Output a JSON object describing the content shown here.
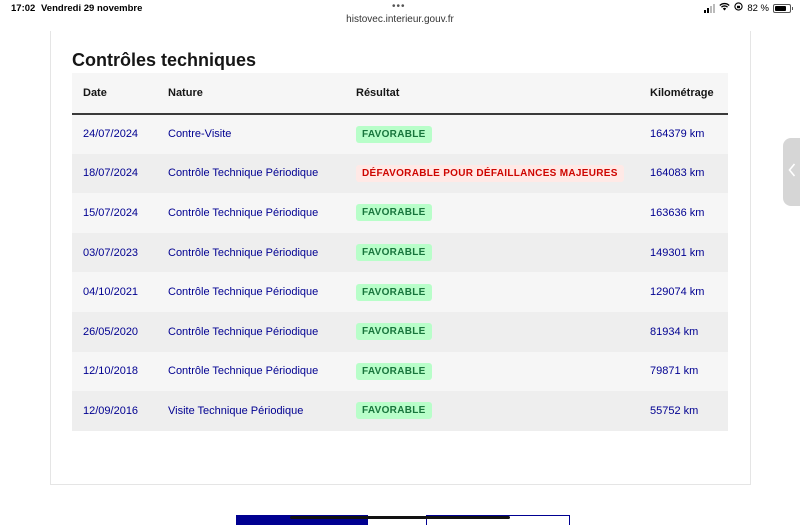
{
  "status_bar": {
    "time": "17:02",
    "date": "Vendredi 29 novembre",
    "battery": "82 %",
    "battery_level": 0.82
  },
  "browser": {
    "url": "histovec.interieur.gouv.fr"
  },
  "section": {
    "title": "Contrôles techniques"
  },
  "table": {
    "headers": {
      "date": "Date",
      "nature": "Nature",
      "resultat": "Résultat",
      "kilometrage": "Kilométrage"
    },
    "rows": [
      {
        "date": "24/07/2024",
        "nature": "Contre-Visite",
        "resultat": "FAVORABLE",
        "status": "ok",
        "km": "164379 km"
      },
      {
        "date": "18/07/2024",
        "nature": "Contrôle Technique Périodique",
        "resultat": "DÉFAVORABLE POUR DÉFAILLANCES MAJEURES",
        "status": "ko",
        "km": "164083 km"
      },
      {
        "date": "15/07/2024",
        "nature": "Contrôle Technique Périodique",
        "resultat": "FAVORABLE",
        "status": "ok",
        "km": "163636 km"
      },
      {
        "date": "03/07/2023",
        "nature": "Contrôle Technique Périodique",
        "resultat": "FAVORABLE",
        "status": "ok",
        "km": "149301 km"
      },
      {
        "date": "04/10/2021",
        "nature": "Contrôle Technique Périodique",
        "resultat": "FAVORABLE",
        "status": "ok",
        "km": "129074 km"
      },
      {
        "date": "26/05/2020",
        "nature": "Contrôle Technique Périodique",
        "resultat": "FAVORABLE",
        "status": "ok",
        "km": "81934 km"
      },
      {
        "date": "12/10/2018",
        "nature": "Contrôle Technique Périodique",
        "resultat": "FAVORABLE",
        "status": "ok",
        "km": "79871 km"
      },
      {
        "date": "12/09/2016",
        "nature": "Visite Technique Périodique",
        "resultat": "FAVORABLE",
        "status": "ok",
        "km": "55752 km"
      }
    ]
  },
  "colors": {
    "primary_blue": "#000091",
    "favorable_bg": "#b8fec9",
    "favorable_text": "#18753c",
    "defavorable_bg": "#ffe9e6",
    "defavorable_text": "#ce0500"
  },
  "icons": {
    "wifi": "wifi-icon",
    "signal": "signal-icon",
    "lock_rotation": "orientation-lock-icon",
    "battery": "battery-icon",
    "side_handle": "chevron-left-icon"
  }
}
